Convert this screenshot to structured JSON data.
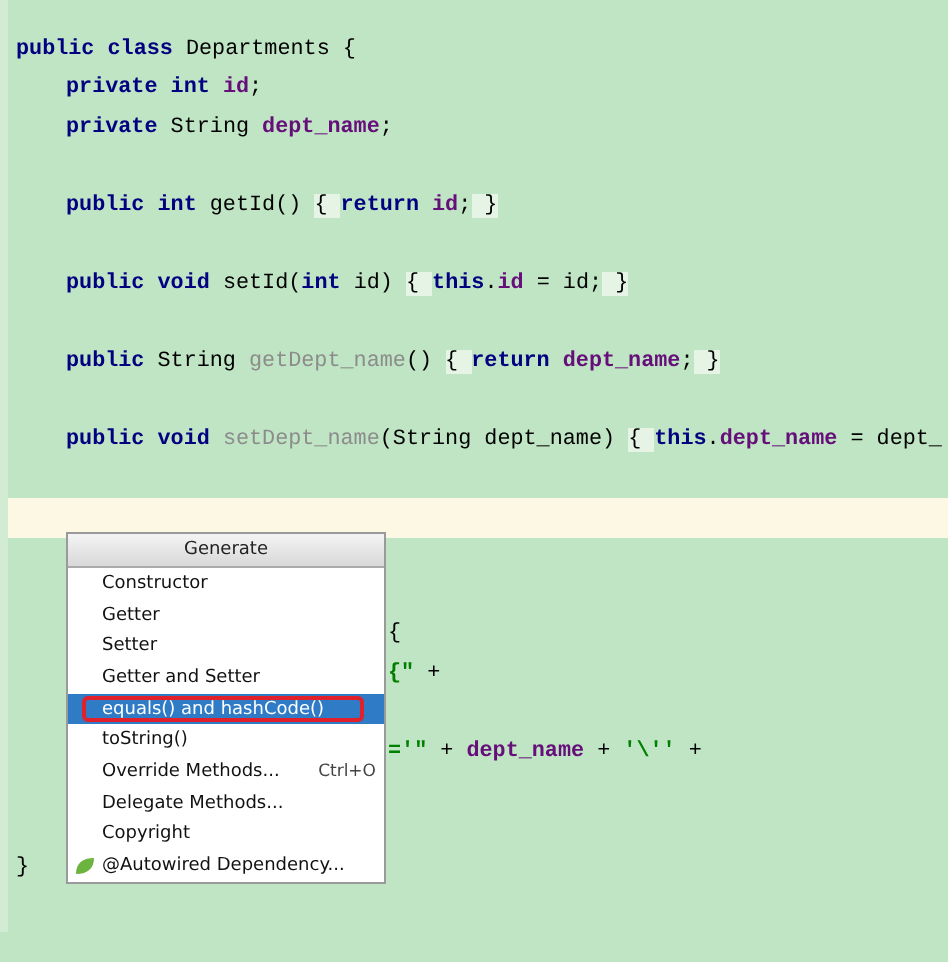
{
  "editor": {
    "lines": [
      {
        "kind": "code",
        "tokens": [
          {
            "kind": "keyword",
            "text": "public class "
          },
          {
            "kind": "plain",
            "text": "Departments {"
          }
        ],
        "children": [
          {
            "kind": "code",
            "tokens": [
              {
                "kind": "keyword",
                "text": "private int "
              },
              {
                "kind": "field",
                "text": "id"
              },
              {
                "kind": "plain",
                "text": ";"
              }
            ]
          },
          {
            "kind": "code",
            "tokens": [
              {
                "kind": "keyword",
                "text": "private "
              },
              {
                "kind": "plain",
                "text": "String "
              },
              {
                "kind": "field",
                "text": "dept_name"
              },
              {
                "kind": "plain",
                "text": ";"
              }
            ]
          },
          {
            "kind": "blank"
          },
          {
            "kind": "code",
            "tokens": [
              {
                "kind": "keyword",
                "text": "public int "
              },
              {
                "kind": "plain",
                "text": "getId() "
              },
              {
                "kind": "fold",
                "text": "{ "
              },
              {
                "kind": "keyword",
                "text": "return "
              },
              {
                "kind": "field",
                "text": "id"
              },
              {
                "kind": "plain",
                "text": ";"
              },
              {
                "kind": "fold",
                "text": " }"
              }
            ]
          },
          {
            "kind": "blank"
          },
          {
            "kind": "code",
            "tokens": [
              {
                "kind": "keyword",
                "text": "public void "
              },
              {
                "kind": "plain",
                "text": "setId("
              },
              {
                "kind": "keyword",
                "text": "int "
              },
              {
                "kind": "plain",
                "text": "id) "
              },
              {
                "kind": "fold",
                "text": "{ "
              },
              {
                "kind": "keyword",
                "text": "this"
              },
              {
                "kind": "plain",
                "text": "."
              },
              {
                "kind": "field",
                "text": "id"
              },
              {
                "kind": "plain",
                "text": " = id;"
              },
              {
                "kind": "fold",
                "text": " }"
              }
            ]
          },
          {
            "kind": "blank"
          },
          {
            "kind": "code",
            "tokens": [
              {
                "kind": "keyword",
                "text": "public "
              },
              {
                "kind": "plain",
                "text": "String "
              },
              {
                "kind": "unused",
                "text": "getDept_name"
              },
              {
                "kind": "plain",
                "text": "() "
              },
              {
                "kind": "fold",
                "text": "{ "
              },
              {
                "kind": "keyword",
                "text": "return "
              },
              {
                "kind": "field",
                "text": "dept_name"
              },
              {
                "kind": "plain",
                "text": ";"
              },
              {
                "kind": "fold",
                "text": " }"
              }
            ]
          },
          {
            "kind": "blank"
          },
          {
            "kind": "code",
            "tokens": [
              {
                "kind": "keyword",
                "text": "public void "
              },
              {
                "kind": "unused",
                "text": "setDept_name"
              },
              {
                "kind": "plain",
                "text": "(String dept_name) "
              },
              {
                "kind": "fold",
                "text": "{ "
              },
              {
                "kind": "keyword",
                "text": "this"
              },
              {
                "kind": "plain",
                "text": "."
              },
              {
                "kind": "field",
                "text": "dept_name"
              },
              {
                "kind": "plain",
                "text": " = dept_"
              }
            ]
          },
          {
            "kind": "blank"
          },
          {
            "kind": "current"
          },
          {
            "kind": "blank"
          },
          {
            "kind": "blank"
          },
          {
            "kind": "covered",
            "tokens": [
              {
                "kind": "plain",
                "text": "{"
              }
            ]
          },
          {
            "kind": "covered",
            "tokens": [
              {
                "kind": "string",
                "text": "{\""
              },
              {
                "kind": "plain",
                "text": " +"
              }
            ]
          },
          {
            "kind": "blank"
          },
          {
            "kind": "covered",
            "tokens": [
              {
                "kind": "string",
                "text": "='\""
              },
              {
                "kind": "plain",
                "text": " + "
              },
              {
                "kind": "field",
                "text": "dept_name"
              },
              {
                "kind": "plain",
                "text": " + "
              },
              {
                "kind": "string",
                "text": "'\\''"
              },
              {
                "kind": "plain",
                "text": " +"
              }
            ]
          },
          {
            "kind": "blank"
          },
          {
            "kind": "blank"
          }
        ]
      },
      {
        "kind": "code",
        "tokens": [
          {
            "kind": "plain",
            "text": "}"
          }
        ]
      }
    ]
  },
  "popup": {
    "title": "Generate",
    "items": [
      {
        "kind": "action",
        "label": "Constructor",
        "selected": false
      },
      {
        "kind": "action",
        "label": "Getter",
        "selected": false
      },
      {
        "kind": "action",
        "label": "Setter",
        "selected": false
      },
      {
        "kind": "action",
        "label": "Getter and Setter",
        "selected": false
      },
      {
        "kind": "action",
        "label": "equals() and hashCode()",
        "selected": true
      },
      {
        "kind": "action",
        "label": "toString()",
        "selected": false
      },
      {
        "kind": "action",
        "label": "Override Methods...",
        "selected": false,
        "shortcut": "Ctrl+O"
      },
      {
        "kind": "action",
        "label": "Delegate Methods...",
        "selected": false
      },
      {
        "kind": "action",
        "label": "Copyright",
        "selected": false
      },
      {
        "kind": "plugin",
        "label": "@Autowired Dependency...",
        "selected": false
      }
    ]
  }
}
